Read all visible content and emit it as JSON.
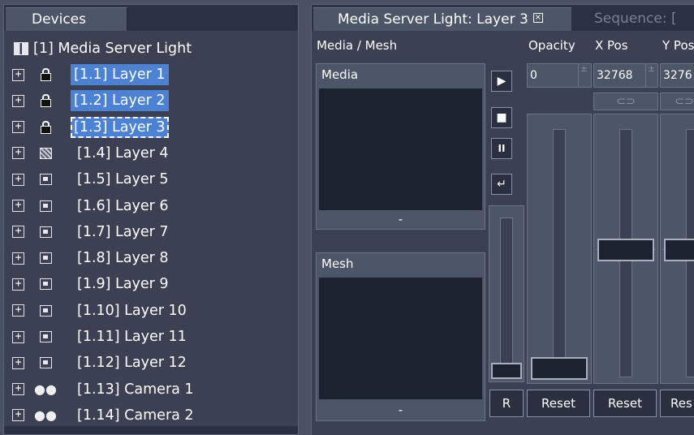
{
  "devices_panel": {
    "tab_label": "Devices",
    "root": "[1] Media Server Light",
    "items": [
      {
        "label": "[1.1] Layer 1",
        "icon": "lock-icon",
        "selected": true
      },
      {
        "label": "[1.2] Layer 2",
        "icon": "lock-icon",
        "selected": true
      },
      {
        "label": "[1.3] Layer 3",
        "icon": "lock-icon",
        "selected": true,
        "focused": true
      },
      {
        "label": "[1.4] Layer 4",
        "icon": "checker-icon"
      },
      {
        "label": "[1.5] Layer 5",
        "icon": "layer-icon"
      },
      {
        "label": "[1.6] Layer 6",
        "icon": "layer-icon"
      },
      {
        "label": "[1.7] Layer 7",
        "icon": "layer-icon"
      },
      {
        "label": "[1.8] Layer 8",
        "icon": "layer-icon"
      },
      {
        "label": "[1.9] Layer 9",
        "icon": "layer-icon"
      },
      {
        "label": "[1.10] Layer 10",
        "icon": "layer-icon"
      },
      {
        "label": "[1.11] Layer 11",
        "icon": "layer-icon"
      },
      {
        "label": "[1.12] Layer 12",
        "icon": "layer-icon"
      },
      {
        "label": "[1.13] Camera 1",
        "icon": "camera-icon"
      },
      {
        "label": "[1.14] Camera 2",
        "icon": "camera-icon"
      }
    ],
    "expander_glyph": "+"
  },
  "editor_panel": {
    "active_tab": "Media Server Light: Layer 3",
    "close_glyph": "×",
    "inactive_tab": "Sequence: [",
    "headers": {
      "media_mesh": "Media / Mesh",
      "opacity": "Opacity",
      "xpos": "X Pos",
      "ypos": "Y Pos"
    },
    "media_box": {
      "title": "Media",
      "value": "-"
    },
    "mesh_box": {
      "title": "Mesh",
      "value": "-"
    },
    "transport": {
      "play": "▶",
      "stop": "■",
      "pause": "II",
      "loop": "↵"
    },
    "r_button": "R",
    "opacity": {
      "value": "0",
      "level": 0.0,
      "reset": "Reset"
    },
    "xpos": {
      "value": "32768",
      "level": 0.5,
      "reset": "Reset"
    },
    "ypos": {
      "value": "3276",
      "level": 0.5,
      "reset": "Res"
    },
    "link_glyph": "⊂⊃",
    "spinner_glyph": "±"
  },
  "colors": {
    "background": "#4a5163",
    "panel": "#3b4153",
    "selection": "#4b82d6",
    "preview": "#1d2230"
  }
}
